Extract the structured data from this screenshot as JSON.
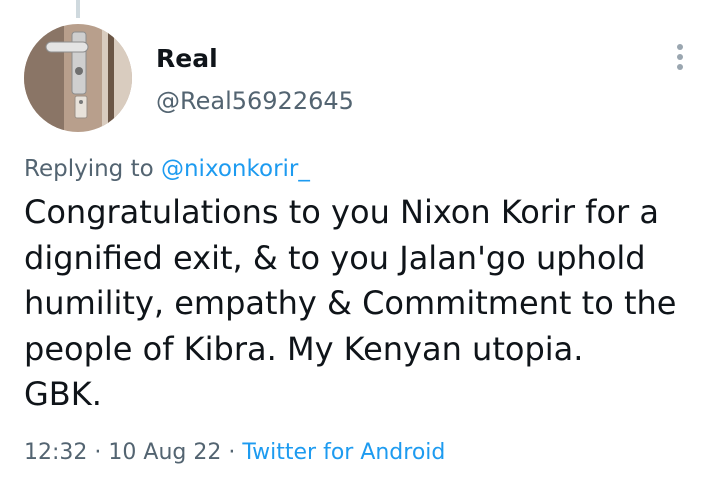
{
  "author": {
    "display_name": "Real",
    "handle": "@Real56922645"
  },
  "reply_context": {
    "prefix": "Replying to",
    "mention": "@nixonkorir_"
  },
  "tweet": {
    "text_lines": [
      "Congratulations to you Nixon Korir for a",
      "dignified exit, & to you Jalan'go uphold",
      "humility, empathy & Commitment to the",
      "people of Kibra. My Kenyan utopia.",
      "GBK."
    ]
  },
  "meta": {
    "time": "12:32",
    "separator_1": "·",
    "date": "10 Aug 22",
    "separator_2": "·",
    "source": "Twitter for Android"
  },
  "icons": {
    "more": "more-vertical-icon",
    "avatar": "door-handle-photo"
  },
  "colors": {
    "accent": "#1d9bf0",
    "secondary_text": "#536471",
    "primary_text": "#0f1419",
    "thread_line": "#cfd9de"
  }
}
